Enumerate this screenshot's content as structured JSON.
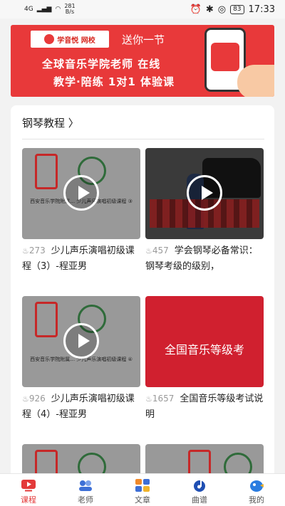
{
  "status_bar": {
    "network": "4G",
    "speed": "281\nB/s",
    "battery": "83",
    "time": "17:33"
  },
  "banner": {
    "logo_text": "学音悦 网校",
    "gift_text": "送你一节",
    "line1": "全球音乐学院老师 在线",
    "line2": "教学·陪练 1对1 体验课"
  },
  "section": {
    "title": "钢琴教程 〉"
  },
  "videos": [
    {
      "views": "273",
      "title": "少儿声乐演唱初级课程（3）-程亚男",
      "caption": "西安音乐学院附属… 少儿声乐演唱初级课程 ③",
      "thumb": "gray"
    },
    {
      "views": "457",
      "title": "学会钢琴必备常识：钢琴考级的级别，",
      "caption": "",
      "thumb": "dark"
    },
    {
      "views": "926",
      "title": "少儿声乐演唱初级课程（4）-程亚男",
      "caption": "西安音乐学院附属… 少儿声乐演唱初级课程 ④",
      "thumb": "gray"
    },
    {
      "views": "1657",
      "title": "全国音乐等级考试说明",
      "caption": "全国音乐等级考",
      "thumb": "red"
    }
  ],
  "tabs": [
    {
      "label": "课程",
      "icon": "course-icon",
      "active": true
    },
    {
      "label": "老师",
      "icon": "teacher-icon",
      "active": false
    },
    {
      "label": "文章",
      "icon": "article-icon",
      "active": false
    },
    {
      "label": "曲谱",
      "icon": "sheet-music-icon",
      "active": false
    },
    {
      "label": "我的",
      "icon": "profile-icon",
      "active": false
    }
  ],
  "colors": {
    "accent": "#e33a3a",
    "banner": "#e8393a"
  }
}
